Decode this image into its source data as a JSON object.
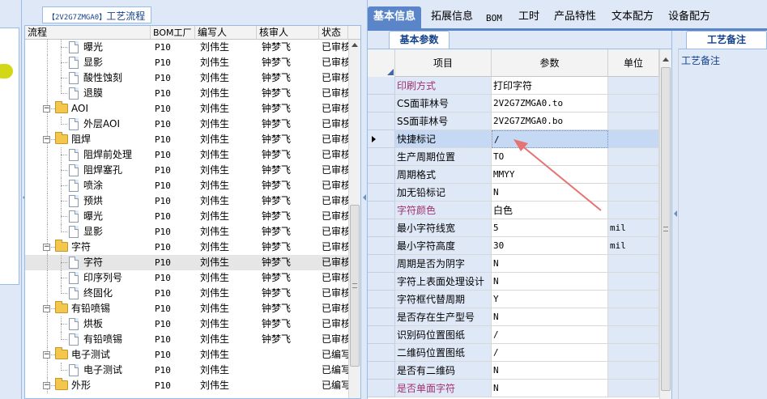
{
  "tree_panel": {
    "title_code": "【2V2G7ZMGA0】",
    "title_label": "工艺流程",
    "columns": [
      "流程",
      "BOM工厂",
      "编写人",
      "核审人",
      "状态"
    ],
    "rows": [
      {
        "name": "曝光",
        "type": "doc",
        "depth": 2,
        "bom": "P10",
        "writer": "刘伟生",
        "reviewer": "钟梦飞",
        "status": "已审核"
      },
      {
        "name": "显影",
        "type": "doc",
        "depth": 2,
        "bom": "P10",
        "writer": "刘伟生",
        "reviewer": "钟梦飞",
        "status": "已审核"
      },
      {
        "name": "酸性蚀刻",
        "type": "doc",
        "depth": 2,
        "bom": "P10",
        "writer": "刘伟生",
        "reviewer": "钟梦飞",
        "status": "已审核"
      },
      {
        "name": "退膜",
        "type": "doc",
        "depth": 2,
        "bom": "P10",
        "writer": "刘伟生",
        "reviewer": "钟梦飞",
        "status": "已审核"
      },
      {
        "name": "AOI",
        "type": "folder",
        "depth": 1,
        "bom": "P10",
        "writer": "刘伟生",
        "reviewer": "钟梦飞",
        "status": "已审核"
      },
      {
        "name": "外层AOI",
        "type": "doc",
        "depth": 2,
        "bom": "P10",
        "writer": "刘伟生",
        "reviewer": "钟梦飞",
        "status": "已审核"
      },
      {
        "name": "阻焊",
        "type": "folder",
        "depth": 1,
        "bom": "P10",
        "writer": "刘伟生",
        "reviewer": "钟梦飞",
        "status": "已审核"
      },
      {
        "name": "阻焊前处理",
        "type": "doc",
        "depth": 2,
        "bom": "P10",
        "writer": "刘伟生",
        "reviewer": "钟梦飞",
        "status": "已审核"
      },
      {
        "name": "阻焊塞孔",
        "type": "doc",
        "depth": 2,
        "bom": "P10",
        "writer": "刘伟生",
        "reviewer": "钟梦飞",
        "status": "已审核"
      },
      {
        "name": "喷涂",
        "type": "doc",
        "depth": 2,
        "bom": "P10",
        "writer": "刘伟生",
        "reviewer": "钟梦飞",
        "status": "已审核"
      },
      {
        "name": "预烘",
        "type": "doc",
        "depth": 2,
        "bom": "P10",
        "writer": "刘伟生",
        "reviewer": "钟梦飞",
        "status": "已审核"
      },
      {
        "name": "曝光",
        "type": "doc",
        "depth": 2,
        "bom": "P10",
        "writer": "刘伟生",
        "reviewer": "钟梦飞",
        "status": "已审核"
      },
      {
        "name": "显影",
        "type": "doc",
        "depth": 2,
        "bom": "P10",
        "writer": "刘伟生",
        "reviewer": "钟梦飞",
        "status": "已审核"
      },
      {
        "name": "字符",
        "type": "folder",
        "depth": 1,
        "bom": "P10",
        "writer": "刘伟生",
        "reviewer": "钟梦飞",
        "status": "已审核"
      },
      {
        "name": "字符",
        "type": "doc",
        "depth": 2,
        "bom": "P10",
        "writer": "刘伟生",
        "reviewer": "钟梦飞",
        "status": "已审核",
        "selected": true
      },
      {
        "name": "印序列号",
        "type": "doc",
        "depth": 2,
        "bom": "P10",
        "writer": "刘伟生",
        "reviewer": "钟梦飞",
        "status": "已审核"
      },
      {
        "name": "终固化",
        "type": "doc",
        "depth": 2,
        "bom": "P10",
        "writer": "刘伟生",
        "reviewer": "钟梦飞",
        "status": "已审核"
      },
      {
        "name": "有铅喷锡",
        "type": "folder",
        "depth": 1,
        "bom": "P10",
        "writer": "刘伟生",
        "reviewer": "钟梦飞",
        "status": "已审核"
      },
      {
        "name": "烘板",
        "type": "doc",
        "depth": 2,
        "bom": "P10",
        "writer": "刘伟生",
        "reviewer": "钟梦飞",
        "status": "已审核"
      },
      {
        "name": "有铅喷锡",
        "type": "doc",
        "depth": 2,
        "bom": "P10",
        "writer": "刘伟生",
        "reviewer": "钟梦飞",
        "status": "已审核"
      },
      {
        "name": "电子测试",
        "type": "folder",
        "depth": 1,
        "bom": "P10",
        "writer": "刘伟生",
        "reviewer": "",
        "status": "已编写"
      },
      {
        "name": "电子测试",
        "type": "doc",
        "depth": 2,
        "bom": "P10",
        "writer": "刘伟生",
        "reviewer": "",
        "status": "已编写"
      },
      {
        "name": "外形",
        "type": "folder",
        "depth": 1,
        "bom": "P10",
        "writer": "刘伟生",
        "reviewer": "",
        "status": "已编写"
      }
    ]
  },
  "main_tabs": [
    {
      "label": "基本信息",
      "active": true
    },
    {
      "label": "拓展信息"
    },
    {
      "label": "BOM"
    },
    {
      "label": "工时"
    },
    {
      "label": "产品特性"
    },
    {
      "label": "文本配方"
    },
    {
      "label": "设备配方"
    }
  ],
  "params_panel": {
    "sub_tab": "基本参数",
    "columns": [
      "项目",
      "参数",
      "单位"
    ],
    "rows": [
      {
        "item": "印刷方式",
        "value": "打印字符",
        "unit": "",
        "pink": true
      },
      {
        "item": "CS面菲林号",
        "value": "2V2G7ZMGA0.to",
        "unit": ""
      },
      {
        "item": "SS面菲林号",
        "value": "2V2G7ZMGA0.bo",
        "unit": ""
      },
      {
        "item": "快捷标记",
        "value": "/",
        "unit": "",
        "selected": true
      },
      {
        "item": "生产周期位置",
        "value": "TO",
        "unit": ""
      },
      {
        "item": "周期格式",
        "value": "MMYY",
        "unit": ""
      },
      {
        "item": "加无铅标记",
        "value": "N",
        "unit": ""
      },
      {
        "item": "字符颜色",
        "value": "白色",
        "unit": "",
        "pink": true
      },
      {
        "item": "最小字符线宽",
        "value": "5",
        "unit": "mil"
      },
      {
        "item": "最小字符高度",
        "value": "30",
        "unit": "mil"
      },
      {
        "item": "周期是否为阴字",
        "value": "N",
        "unit": ""
      },
      {
        "item": "字符上表面处理设计",
        "value": "N",
        "unit": ""
      },
      {
        "item": "字符框代替周期",
        "value": "Y",
        "unit": ""
      },
      {
        "item": "是否存在生产型号",
        "value": "N",
        "unit": ""
      },
      {
        "item": "识别码位置图纸",
        "value": "/",
        "unit": ""
      },
      {
        "item": "二维码位置图纸",
        "value": "/",
        "unit": ""
      },
      {
        "item": "是否有二维码",
        "value": "N",
        "unit": ""
      },
      {
        "item": "是否单面字符",
        "value": "N",
        "unit": "",
        "pink": true
      }
    ]
  },
  "notes_panel": {
    "tab": "工艺备注",
    "label": "工艺备注"
  },
  "colors": {
    "active_tab": "#5a86c9",
    "panel_bg": "#dfe8f6",
    "pink_label": "#a03070",
    "annotation_arrow": "#e57373"
  }
}
